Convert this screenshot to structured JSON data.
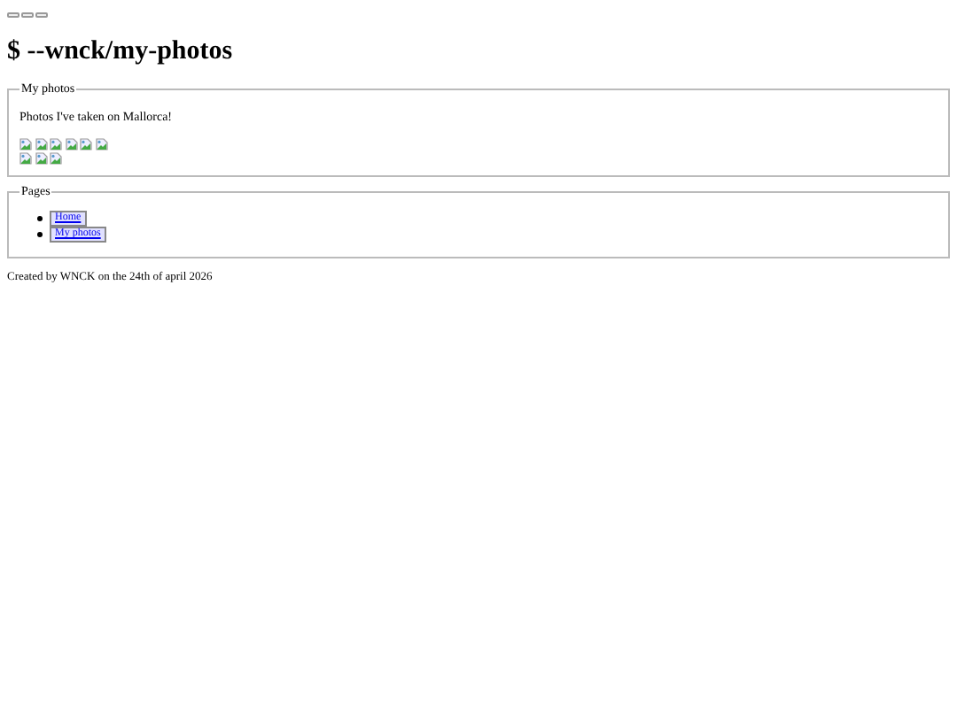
{
  "top_buttons": [
    {
      "kind": "button"
    },
    {
      "kind": "button"
    },
    {
      "kind": "button"
    }
  ],
  "title": "$ --wnck/my-photos",
  "photos_section": {
    "legend": "My photos",
    "text": "Photos I've taken on Mallorca!",
    "photo_rows": [
      [
        {
          "kind": "broken-image"
        },
        {
          "kind": "broken-image"
        },
        {
          "kind": "broken-image"
        },
        {
          "kind": "broken-image"
        },
        {
          "kind": "broken-image"
        },
        {
          "kind": "broken-image"
        }
      ],
      [
        {
          "kind": "broken-image"
        },
        {
          "kind": "broken-image"
        },
        {
          "kind": "broken-image"
        }
      ]
    ]
  },
  "pages_section": {
    "legend": "Pages",
    "links": [
      {
        "label": "Home"
      },
      {
        "label": "My photos"
      }
    ]
  },
  "footer": "Created by WNCK on the 24th of april 2026"
}
